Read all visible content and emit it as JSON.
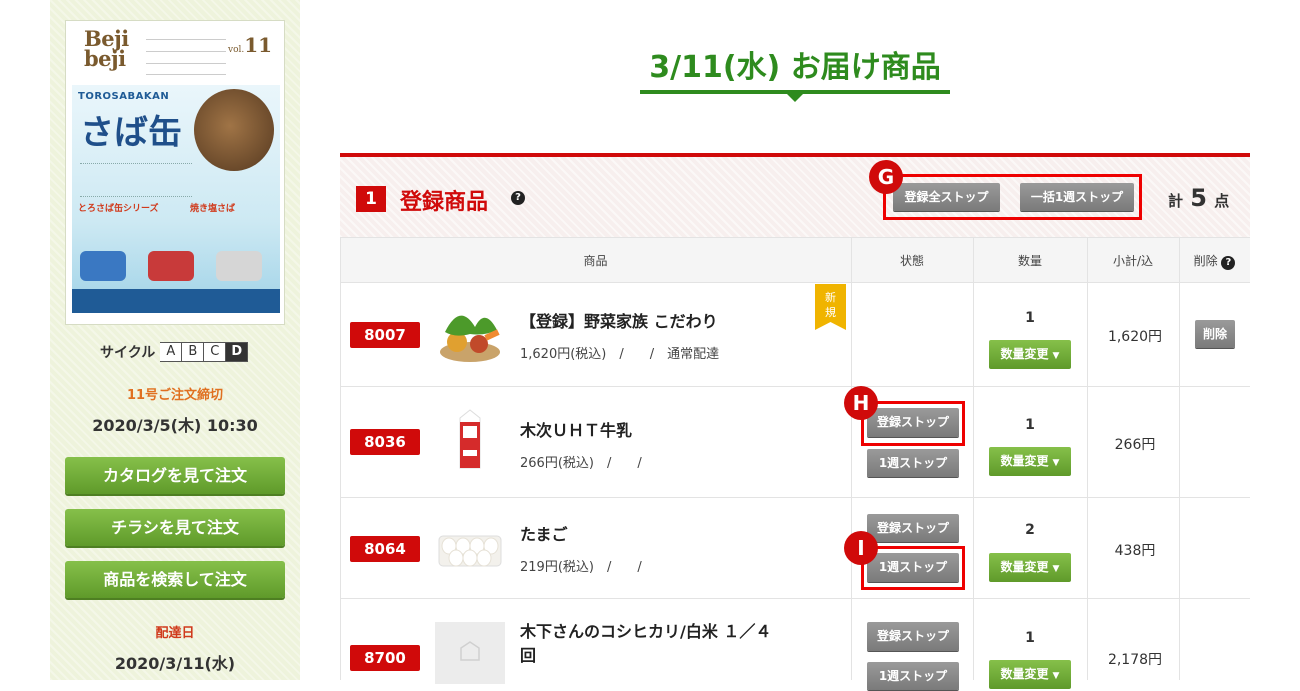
{
  "sidebar": {
    "catalog": {
      "logo_line1": "Beji",
      "logo_line2": "beji",
      "vol_label": "vol.",
      "vol_num": "11",
      "brand": "TOROSABAKAN",
      "title": "さば缶",
      "series_label": "とろさば缶シリーズ",
      "series_label2": "焼き塩さば"
    },
    "cycle_label": "サイクル",
    "cycles": [
      "A",
      "B",
      "C",
      "D"
    ],
    "active_cycle": "D",
    "deadline_label": "11号ご注文締切",
    "deadline_value": "2020/3/5(木) 10:30",
    "buttons": [
      "カタログを見て注文",
      "チラシを見て注文",
      "商品を検索して注文"
    ],
    "delivery_label": "配達日",
    "delivery_value": "2020/3/11(水)"
  },
  "main": {
    "page_title": "3/11(水) お届け商品",
    "section_number": "1",
    "section_title": "登録商品",
    "stop_all_label": "登録全ストップ",
    "stop_week_all_label": "一括1週ストップ",
    "total_prefix": "計",
    "total_count": "5",
    "total_suffix": "点",
    "markers": {
      "g": "G",
      "h": "H",
      "i": "I"
    },
    "columns": {
      "product": "商品",
      "status": "状態",
      "quantity": "数量",
      "subtotal": "小計/込",
      "delete": "削除"
    },
    "new_badge": "新規",
    "qty_change_label": "数量変更",
    "stop_reg_label": "登録ストップ",
    "stop_week_label": "1週ストップ",
    "delete_label": "削除",
    "rows": [
      {
        "code": "8007",
        "name": "【登録】野菜家族 こだわり",
        "info": "1,620円(税込)　/　　/　通常配達",
        "qty": "1",
        "subtotal": "1,620円"
      },
      {
        "code": "8036",
        "name": "木次ＵＨＴ牛乳",
        "info": "266円(税込)　/　　/",
        "qty": "1",
        "subtotal": "266円"
      },
      {
        "code": "8064",
        "name": "たまご",
        "info": "219円(税込)　/　　/",
        "qty": "2",
        "subtotal": "438円"
      },
      {
        "code": "8700",
        "name_line1": "木下さんのコシヒカリ/白米 １／４",
        "name_line2": "回",
        "qty": "1",
        "subtotal": "2,178円"
      }
    ]
  },
  "colors": {
    "brand_red": "#d00a0a",
    "title_green": "#2e8b1e",
    "button_green": "#6fa935",
    "deadline_orange": "#e07020"
  }
}
